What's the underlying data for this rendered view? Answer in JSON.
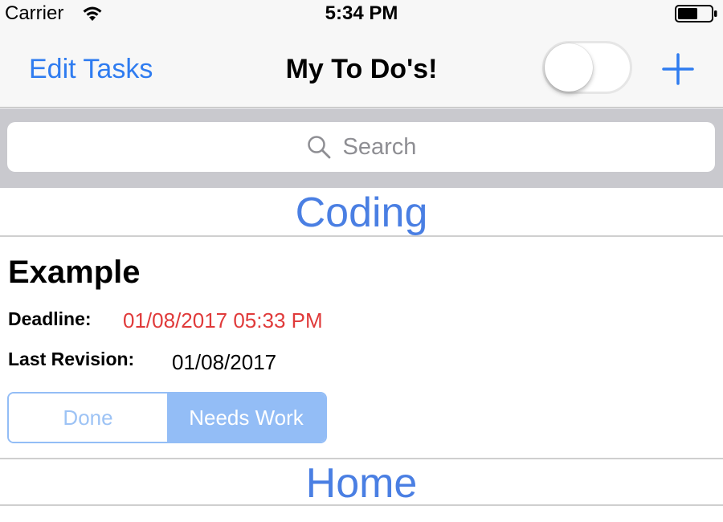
{
  "status_bar": {
    "carrier": "Carrier",
    "time": "5:34 PM"
  },
  "nav": {
    "edit_label": "Edit Tasks",
    "title": "My To Do's!",
    "toggle_on": false,
    "add_icon": "plus-icon"
  },
  "search": {
    "placeholder": "Search",
    "icon": "search-icon"
  },
  "sections": [
    {
      "title": "Coding",
      "tasks": [
        {
          "title": "Example",
          "deadline_label": "Deadline:",
          "deadline_value": "01/08/2017 05:33 PM",
          "revision_label": "Last Revision:",
          "revision_value": "01/08/2017",
          "segments": [
            "Done",
            "Needs Work"
          ],
          "selected_segment": "Needs Work"
        }
      ]
    },
    {
      "title": "Home",
      "tasks": []
    }
  ],
  "colors": {
    "accent": "#2f7cf0",
    "section_header": "#4a7fe3",
    "deadline": "#e03a3a",
    "segment": "#93bdf6"
  }
}
